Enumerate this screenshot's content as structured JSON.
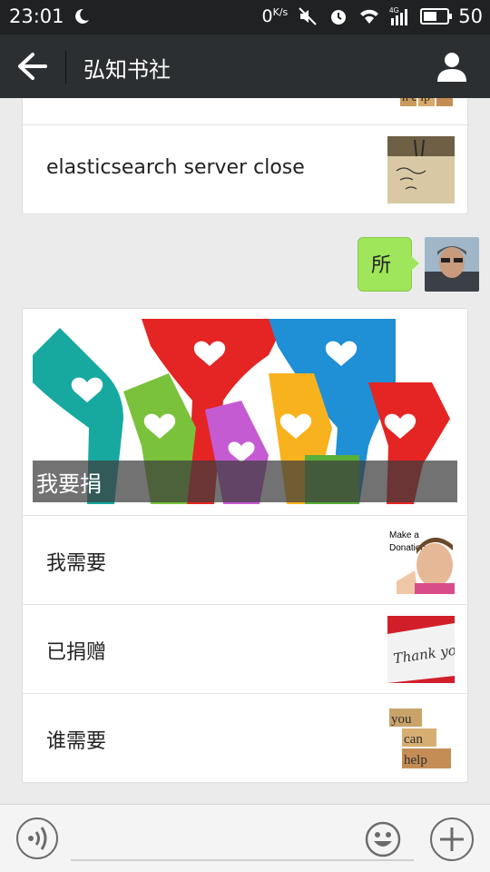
{
  "status_bar": {
    "time": "23:01",
    "net_speed": "0",
    "net_unit": "K/s",
    "network": "4G",
    "battery": "50"
  },
  "header": {
    "title": "弘知书社"
  },
  "messages": {
    "top_card": {
      "items": [
        {
          "label": "",
          "thumb": "can-help-blocks"
        },
        {
          "label": "elasticsearch server close",
          "thumb": "handwritten-note-photo"
        }
      ]
    },
    "sent_bubble": {
      "text": "所",
      "avatar": "user-photo"
    },
    "donation_card": {
      "hero_caption": "我要捐",
      "hero_image": "colorful-hands-with-hearts",
      "items": [
        {
          "label": "我需要",
          "thumb": "make-a-donation-child",
          "thumb_text": "Make a Donation"
        },
        {
          "label": "已捐赠",
          "thumb": "thank-you-card",
          "thumb_text": "Thank you"
        },
        {
          "label": "谁需要",
          "thumb": "you-can-help-blocks",
          "thumb_text": "you can help"
        }
      ]
    }
  },
  "colors": {
    "title_bar": "#2b2f31",
    "status_bar": "#1f2122",
    "bubble": "#9fe65a",
    "background": "#ebebeb"
  },
  "bottom_bar": {
    "icons": [
      "voice-icon",
      "emoji-icon",
      "plus-icon"
    ]
  }
}
